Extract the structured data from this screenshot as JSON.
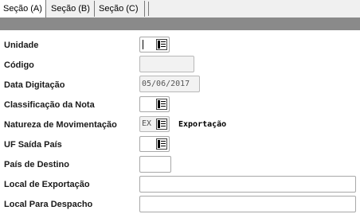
{
  "tabs": [
    {
      "label": "Seção (A)"
    },
    {
      "label": "Seção (B)"
    },
    {
      "label": "Seção (C)"
    }
  ],
  "form": {
    "unidade": {
      "label": "Unidade",
      "value": ""
    },
    "codigo": {
      "label": "Código",
      "value": ""
    },
    "data_digitacao": {
      "label": "Data Digitação",
      "value": "05/06/2017"
    },
    "classificacao": {
      "label": "Classificação da Nota",
      "value": ""
    },
    "natureza": {
      "label": "Natureza de Movimentação",
      "value": "EX",
      "description": "Exportação"
    },
    "uf_saida": {
      "label": "UF Saída País",
      "value": ""
    },
    "pais_destino": {
      "label": "País de Destino",
      "value": ""
    },
    "local_exportacao": {
      "label": "Local de Exportação",
      "value": ""
    },
    "local_despacho": {
      "label": "Local Para Despacho",
      "value": ""
    }
  },
  "icons": {
    "lookup": "lookup-list-icon"
  }
}
